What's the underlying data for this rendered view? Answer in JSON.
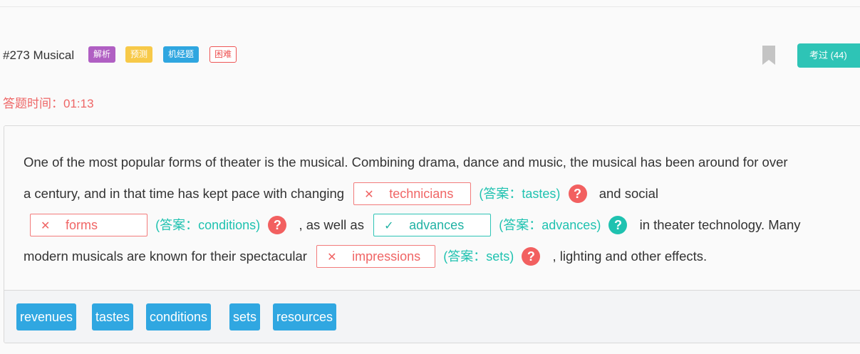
{
  "header": {
    "question_title": "#273 Musical",
    "tags": [
      {
        "label": "解析",
        "color": "#b05fc3"
      },
      {
        "label": "预测",
        "color": "#f7c948"
      },
      {
        "label": "机经题",
        "color": "#2fa6e0"
      },
      {
        "label": "困难",
        "color": "#ee5555"
      }
    ],
    "exam_button": "考过 (44)"
  },
  "timer": "答题时间：01:13",
  "passage": {
    "line1": "One of the most popular forms of theater is the musical. Combining drama, dance and music, the musical has been around for over",
    "line2_pre": "a century, and in that time has kept pace with changing",
    "line2_post": "and social",
    "line3_mid": ", as well as",
    "line3_post": "in theater technology. Many",
    "line4_pre": "modern musicals are known for their spectacular",
    "line4_post": ", lighting and other effects.",
    "blanks": [
      {
        "user_answer": "technicians",
        "status": "wrong",
        "mark": "✕",
        "correct_text": "(答案：tastes)"
      },
      {
        "user_answer": "forms",
        "status": "wrong",
        "mark": "✕",
        "correct_text": "(答案：conditions)"
      },
      {
        "user_answer": "advances",
        "status": "correct",
        "mark": "✓",
        "correct_text": "(答案：advances)"
      },
      {
        "user_answer": "impressions",
        "status": "wrong",
        "mark": "✕",
        "correct_text": "(答案：sets)"
      }
    ],
    "help_glyph": "?"
  },
  "options": [
    "revenues",
    "tastes",
    "conditions",
    "sets",
    "resources"
  ],
  "colors": {
    "accent_teal": "#2ec4b6",
    "wrong_red": "#f06565",
    "option_blue": "#30a7e1",
    "timer_red": "#ee6666"
  }
}
